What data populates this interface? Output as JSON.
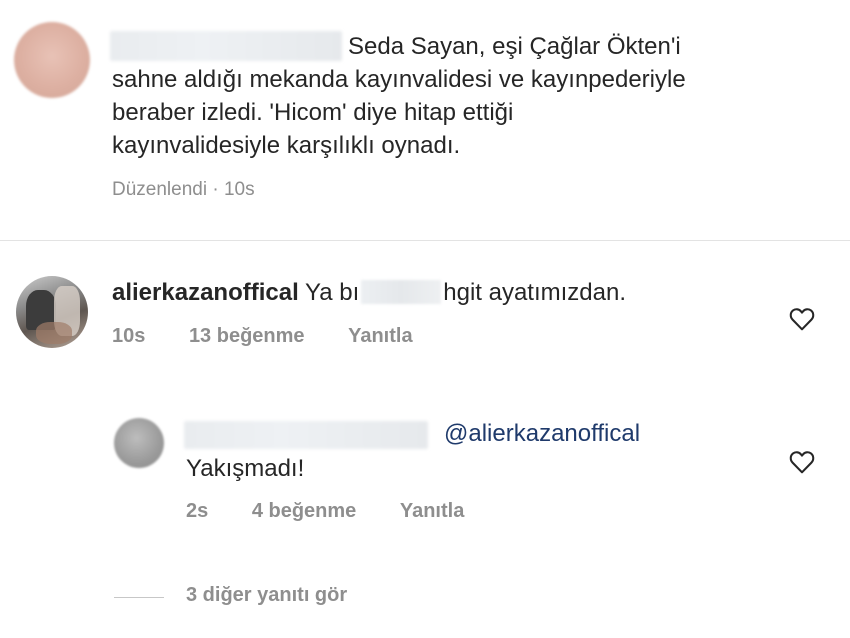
{
  "caption": {
    "text": "Seda Sayan, eşi Çağlar Ökten'i\nsahne aldığı mekanda kayınvalidesi ve kayınpederiyle\nberaber izledi. 'Hicom' diye hitap ettiği\nkayınvalidesiyle karşılıklı oynadı.",
    "meta": "Düzenlendi · 10s"
  },
  "comment": {
    "username": "alierkazanoffical",
    "text_start": "Ya bı",
    "text_end": "hgit ayatımızdan.",
    "time": "10s",
    "likes": "13 beğenme",
    "reply_label": "Yanıtla",
    "like_icon": "heart-icon"
  },
  "reply": {
    "mention": "@alierkazanoffical",
    "text": "Yakışmadı!",
    "time": "2s",
    "likes": "4 beğenme",
    "reply_label": "Yanıtla",
    "like_icon": "heart-icon"
  },
  "more_replies": {
    "label": "3 diğer yanıtı gör"
  }
}
